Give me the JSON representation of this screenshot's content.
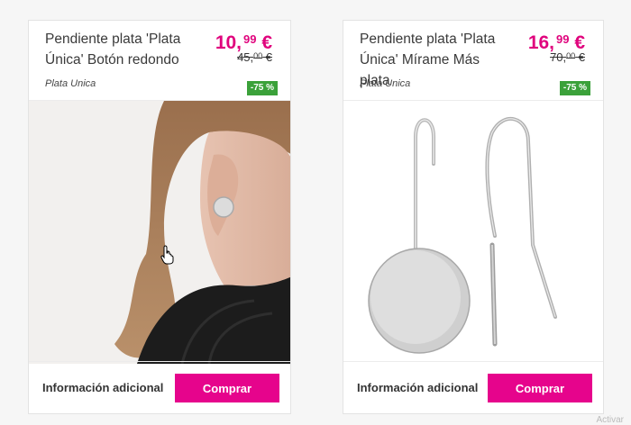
{
  "products": [
    {
      "title": "Pendiente plata 'Plata Única' Botón redondo",
      "price_int": "10,",
      "price_dec": "99",
      "price_cur": " €",
      "old_int": "45,",
      "old_dec": "00",
      "old_cur": " €",
      "brand": "Plata Unica",
      "discount": "-75 %",
      "info_label": "Información adicional",
      "buy_label": "Comprar"
    },
    {
      "title": "Pendiente plata 'Plata Única' Mírame Más plata",
      "price_int": "16,",
      "price_dec": "99",
      "price_cur": " €",
      "old_int": "70,",
      "old_dec": "00",
      "old_cur": " €",
      "brand": "Plata Unica",
      "discount": "-75 %",
      "info_label": "Información adicional",
      "buy_label": "Comprar"
    }
  ],
  "colors": {
    "accent": "#e6048c",
    "price": "#e0047d",
    "badge": "#3ba13a"
  },
  "watermark": "Activar"
}
